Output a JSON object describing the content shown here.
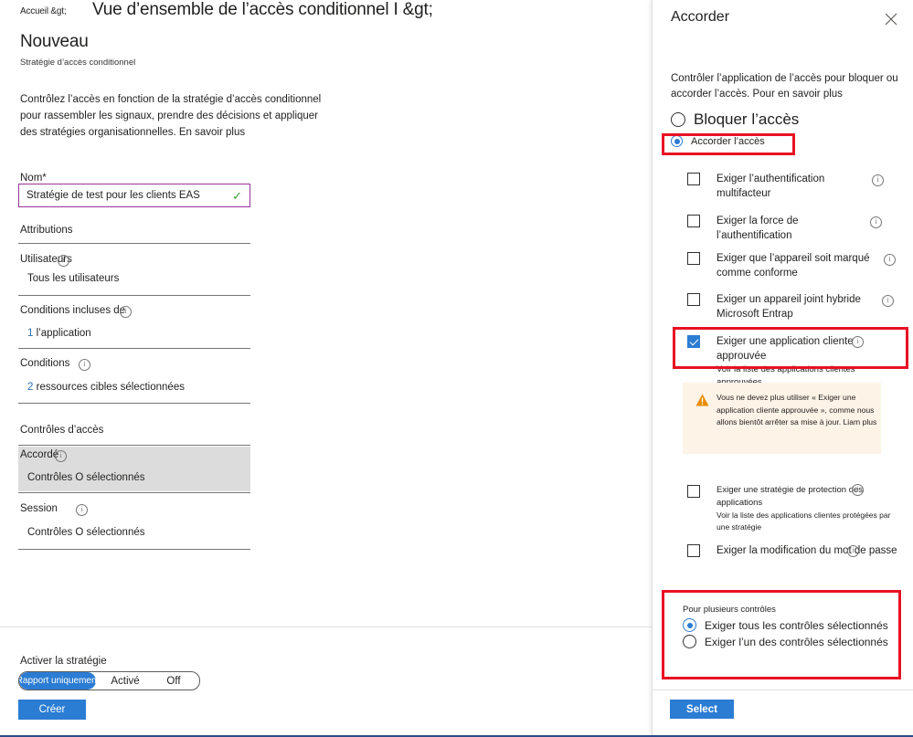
{
  "left": {
    "breadcrumb": "Accueil &gt;",
    "title_line1": "Vue d’ensemble de l’accès conditionnel I &gt;",
    "title_line2": "Nouveau",
    "subtitle": "Stratégie d’accès conditionnel",
    "intro": "Contrôlez l’accès en fonction de la stratégie d’accès conditionnel pour rassembler les signaux, prendre des décisions et appliquer des stratégies organisationnelles. En savoir plus",
    "name_label": "Nom*",
    "name_value": "Stratégie de test pour les clients EAS",
    "name_valid_icon": "check-icon",
    "sections": {
      "assignments_heading": "Attributions",
      "users_label": "Utilisateurs",
      "users_value": "Tous les utilisateurs",
      "included_conditions_label": "Conditions incluses de",
      "included_conditions_count": "1",
      "included_conditions_value": "l’application",
      "conditions_label": "Conditions",
      "conditions_count": "2",
      "conditions_value": "ressources cibles sélectionnées",
      "access_controls_heading": "Contrôles d’accès",
      "grant_label": "Accordé",
      "grant_value": "Contrôles O sélectionnés",
      "session_label": "Session",
      "session_value": "Contrôles O sélectionnés"
    },
    "footer": {
      "activate_label": "Activer la stratégie",
      "toggle_options": [
        "Rapport uniquement",
        "Activé",
        "Off"
      ],
      "toggle_selected": "Rapport uniquement",
      "create_button": "Créer"
    }
  },
  "panel": {
    "title": "Accorder",
    "close_icon": "close-icon",
    "description": "Contrôler l’application de l’accès pour bloquer ou accorder l’accès. Pour en savoir plus",
    "mode_options": [
      {
        "label": "Bloquer l’accès",
        "selected": false
      },
      {
        "label": "Accorder l’accès",
        "selected": true
      }
    ],
    "controls": [
      {
        "label": "Exiger l’authentification multifacteur",
        "checked": false,
        "info": true,
        "sub": ""
      },
      {
        "label": "Exiger la force de l’authentification",
        "checked": false,
        "info": true,
        "sub": ""
      },
      {
        "label": "Exiger que l’appareil soit marqué comme conforme",
        "checked": false,
        "info": true,
        "sub": ""
      },
      {
        "label": "Exiger un appareil joint hybride Microsoft Entrap",
        "checked": false,
        "info": true,
        "sub": ""
      },
      {
        "label": "Exiger une application cliente approuvée",
        "checked": true,
        "info": true,
        "sub": "Voir la liste des applications clientes approuvées"
      },
      {
        "label": "Exiger une stratégie de protection des applications",
        "checked": false,
        "info": true,
        "sub": "Voir la liste des applications clientes protégées par une stratégie"
      },
      {
        "label": "Exiger la modification du mot de passe",
        "checked": false,
        "info": true,
        "sub": ""
      }
    ],
    "warning": {
      "icon": "warning-triangle-icon",
      "text": "Vous ne devez plus utiliser « Exiger une application cliente approuvée », comme nous allons bientôt arrêter sa mise à jour. Liam plus"
    },
    "multi": {
      "heading": "Pour plusieurs contrôles",
      "options": [
        {
          "label": "Exiger tous les contrôles sélectionnés",
          "selected": true
        },
        {
          "label": "Exiger l’un des contrôles sélectionnés",
          "selected": false
        }
      ]
    },
    "select_button": "Select"
  },
  "colors": {
    "accent_blue": "#2b7cd3",
    "highlight_red": "#e81123",
    "input_border": "#993399",
    "valid_green": "#3a9b35",
    "warning_bg": "#fdf3e7",
    "warning_orange": "#e88b00",
    "grey_highlight": "#dcdcdc"
  }
}
